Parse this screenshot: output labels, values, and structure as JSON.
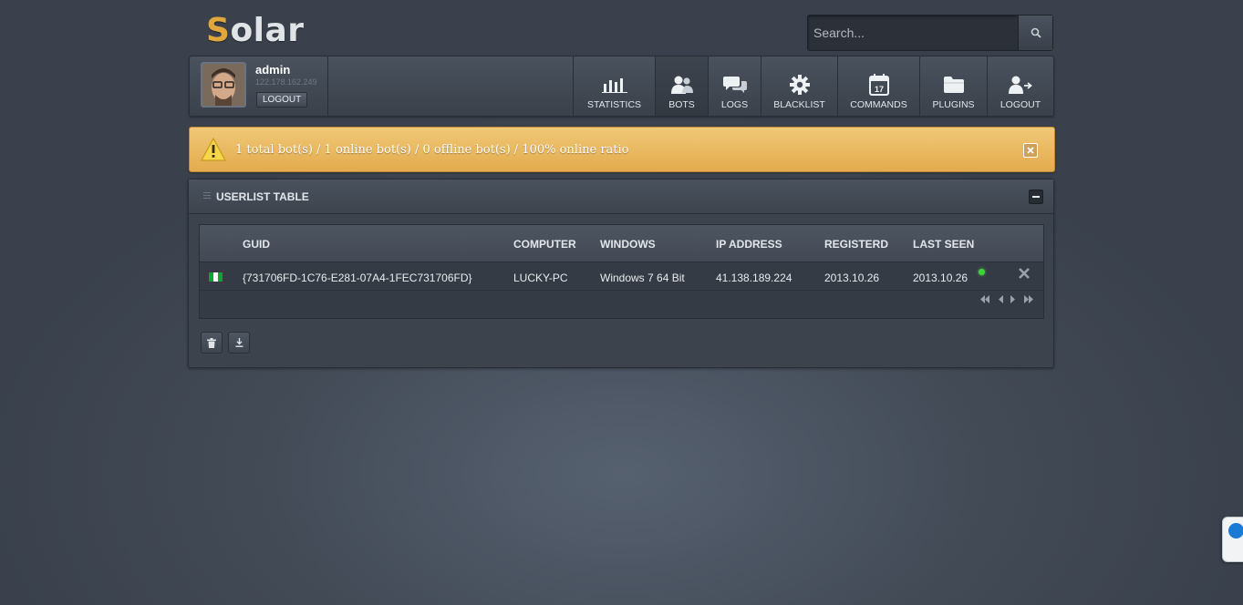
{
  "brand": {
    "logo_first": "S",
    "logo_rest": "olar",
    "accent": "#e0a83c"
  },
  "search": {
    "placeholder": "Search..."
  },
  "user": {
    "name": "admin",
    "ip": "122.178.162.249",
    "logout_label": "LOGOUT"
  },
  "nav": {
    "items": [
      {
        "label": "STATISTICS",
        "icon": "bar-chart-icon"
      },
      {
        "label": "BOTS",
        "icon": "users-icon",
        "active": true
      },
      {
        "label": "LOGS",
        "icon": "chat-icon"
      },
      {
        "label": "BLACKLIST",
        "icon": "gear-icon"
      },
      {
        "label": "COMMANDS",
        "icon": "calendar-icon",
        "icon_text": "17"
      },
      {
        "label": "PLUGINS",
        "icon": "folder-icon"
      },
      {
        "label": "LOGOUT",
        "icon": "user-logout-icon"
      }
    ]
  },
  "alert": {
    "message": "1 total bot(s) / 1 online bot(s) / 0 offline bot(s) / 100% online ratio",
    "color": "#e8b55d"
  },
  "panel": {
    "title": "USERLIST TABLE",
    "columns": [
      "GUID",
      "COMPUTER",
      "WINDOWS",
      "IP ADDRESS",
      "REGISTERD",
      "LAST SEEN"
    ],
    "rows": [
      {
        "flag": "nigeria-flag-icon",
        "guid": "{731706FD-1C76-E281-07A4-1FEC731706FD}",
        "computer": "LUCKY-PC",
        "windows": "Windows 7 64 Bit",
        "ip": "41.138.189.224",
        "registered": "2013.10.26",
        "last_seen": "2013.10.26",
        "online": true,
        "online_color": "#3bd43b"
      }
    ]
  }
}
